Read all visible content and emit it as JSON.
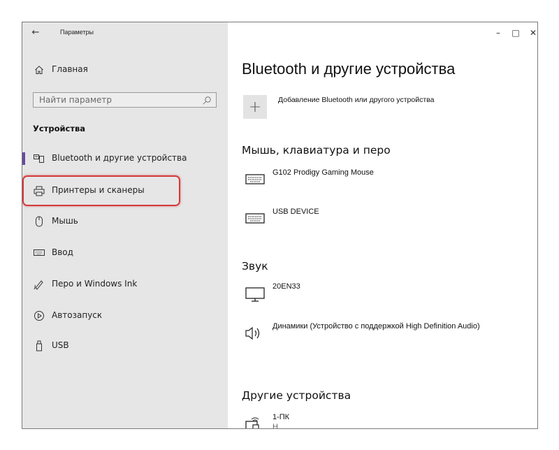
{
  "window": {
    "app_title": "Параметры",
    "back_icon": "←",
    "controls": {
      "minimize": "–",
      "maximize": "□",
      "close": "✕"
    }
  },
  "sidebar": {
    "home_label": "Главная",
    "search_placeholder": "Найти параметр",
    "section_title": "Устройства",
    "items": [
      {
        "label": "Bluetooth и другие устройства",
        "icon": "bluetooth-devices-icon",
        "selected": true
      },
      {
        "label": "Принтеры и сканеры",
        "icon": "printer-icon",
        "selected": false
      },
      {
        "label": "Мышь",
        "icon": "mouse-icon",
        "selected": false
      },
      {
        "label": "Ввод",
        "icon": "keyboard-icon",
        "selected": false
      },
      {
        "label": "Перо и Windows Ink",
        "icon": "pen-icon",
        "selected": false
      },
      {
        "label": "Автозапуск",
        "icon": "autoplay-icon",
        "selected": false
      },
      {
        "label": "USB",
        "icon": "usb-icon",
        "selected": false
      }
    ]
  },
  "main": {
    "title": "Bluetooth и другие устройства",
    "add_device_label": "Добавление Bluetooth или другого устройства",
    "add_icon": "+",
    "groups": {
      "input": {
        "heading": "Мышь, клавиатура и перо",
        "devices": [
          {
            "name": "G102 Prodigy Gaming Mouse",
            "icon": "keyboard-icon"
          },
          {
            "name": "USB DEVICE",
            "icon": "keyboard-icon"
          }
        ]
      },
      "audio": {
        "heading": "Звук",
        "devices": [
          {
            "name": "20EN33",
            "icon": "monitor-icon"
          },
          {
            "name": "Динамики (Устройство с поддержкой High Definition Audio)",
            "icon": "speaker-icon"
          }
        ]
      },
      "other": {
        "heading": "Другие устройства",
        "devices": [
          {
            "name": "1-ПК",
            "sub": "Н",
            "icon": "network-device-icon"
          }
        ]
      }
    }
  },
  "colors": {
    "sidebar_bg": "#e6e6e6",
    "accent": "#6b4aa0",
    "highlight": "#d63a3a"
  }
}
